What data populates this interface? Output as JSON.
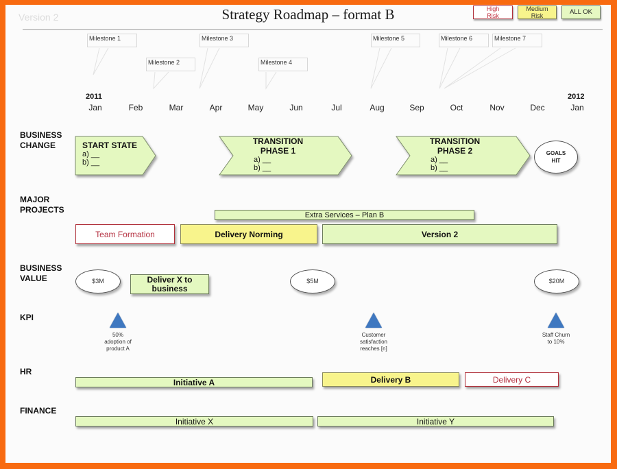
{
  "header": {
    "version": "Version 2",
    "title": "Strategy Roadmap – format B"
  },
  "legend": {
    "high_risk": "High Risk",
    "medium_risk": "Medium Risk",
    "all_ok": "ALL OK",
    "colors": {
      "high_risk": "#b0303a",
      "medium_risk": "#f8f48c",
      "all_ok": "#e4f8c0"
    }
  },
  "milestones": [
    {
      "label": "Milestone 1",
      "month": "Jan"
    },
    {
      "label": "Milestone 2",
      "month": "Mar"
    },
    {
      "label": "Milestone 3",
      "month": "Apr"
    },
    {
      "label": "Milestone 4",
      "month": "Jun"
    },
    {
      "label": "Milestone 5",
      "month": "Aug"
    },
    {
      "label": "Milestone 6",
      "month": "Oct"
    },
    {
      "label": "Milestone 7",
      "month": "Oct"
    }
  ],
  "timeline": {
    "start_year": "2011",
    "end_year": "2012",
    "months": [
      "Jan",
      "Feb",
      "Mar",
      "Apr",
      "May",
      "Jun",
      "Jul",
      "Aug",
      "Sep",
      "Oct",
      "Nov",
      "Dec",
      "Jan"
    ]
  },
  "rows": {
    "business_change": {
      "label_line1": "BUSINESS",
      "label_line2": "CHANGE",
      "start_state": {
        "title": "START STATE",
        "a": "a)  __",
        "b": "b)  __"
      },
      "phase1": {
        "title1": "TRANSITION",
        "title2": "PHASE 1",
        "a": "a) __",
        "b": "b) __"
      },
      "phase2": {
        "title1": "TRANSITION",
        "title2": "PHASE 2",
        "a": "a) __",
        "b": "b) __"
      },
      "goals": {
        "line1": "GOALS",
        "line2": "HIT"
      }
    },
    "major_projects": {
      "label_line1": "MAJOR",
      "label_line2": "PROJECTS",
      "extra_services": "Extra Services – Plan B",
      "team_formation": "Team Formation",
      "delivery_norming": "Delivery Norming",
      "version2": "Version 2"
    },
    "business_value": {
      "label_line1": "BUSINESS",
      "label_line2": "VALUE",
      "v1": "$3M",
      "deliver_x_line1": "Deliver X to",
      "deliver_x_line2": "business",
      "v2": "$5M",
      "v3": "$20M"
    },
    "kpi": {
      "label": "KPI",
      "items": [
        {
          "line1": "50%",
          "line2": "adoption of",
          "line3": "product A"
        },
        {
          "line1": "Customer",
          "line2": "satisfaction",
          "line3": "reaches [n]"
        },
        {
          "line1": "Staff Churn",
          "line2": "to 10%",
          "line3": ""
        }
      ]
    },
    "hr": {
      "label": "HR",
      "initiative_a": "Initiative A",
      "delivery_b": "Delivery B",
      "delivery_c": "Delivery C"
    },
    "finance": {
      "label": "FINANCE",
      "initiative_x": "Initiative X",
      "initiative_y": "Initiative Y"
    }
  }
}
